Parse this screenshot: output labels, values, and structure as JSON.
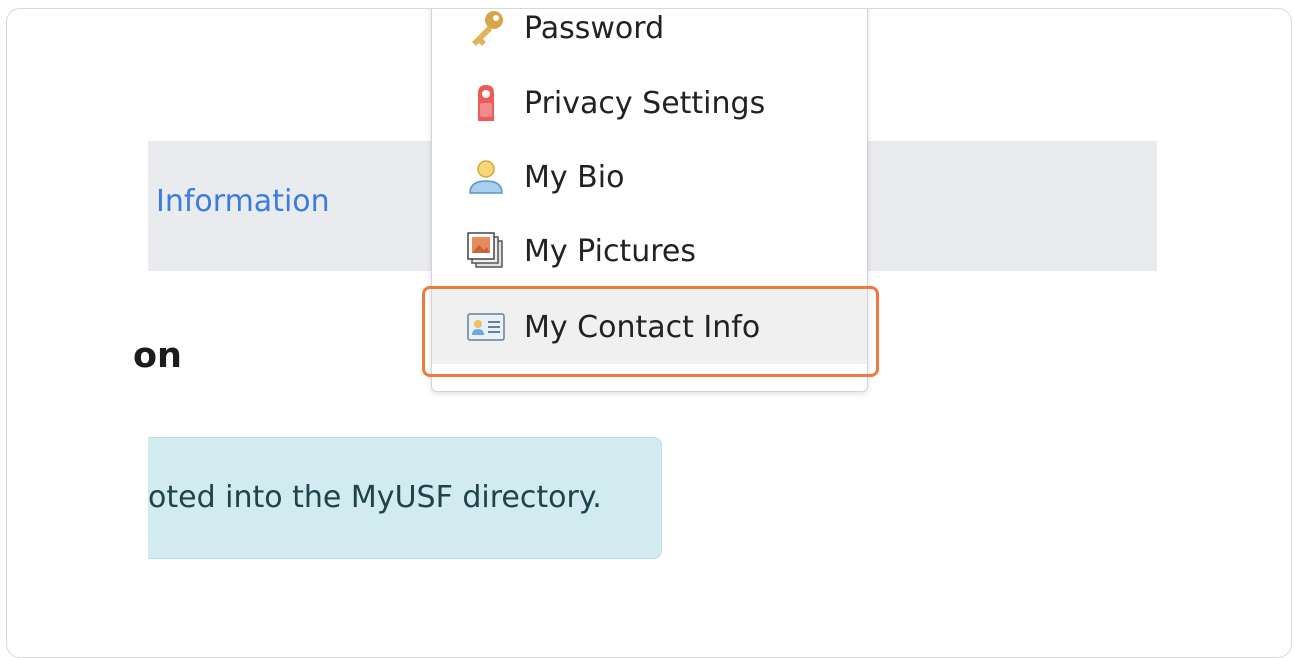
{
  "header": {
    "link_label": "Information"
  },
  "section": {
    "title": "on"
  },
  "alert": {
    "text": "oted into the MyUSF directory."
  },
  "menu": {
    "items": [
      {
        "label": "Password",
        "icon": "key-icon"
      },
      {
        "label": "Privacy Settings",
        "icon": "door-hanger-icon"
      },
      {
        "label": "My Bio",
        "icon": "user-icon"
      },
      {
        "label": "My Pictures",
        "icon": "pictures-icon"
      },
      {
        "label": "My Contact Info",
        "icon": "contact-card-icon",
        "selected": true
      }
    ]
  },
  "colors": {
    "highlight": "#f07a3c",
    "link": "#3a7de0",
    "alert_bg": "#d1ebf1",
    "header_bg": "#e9ebee"
  }
}
